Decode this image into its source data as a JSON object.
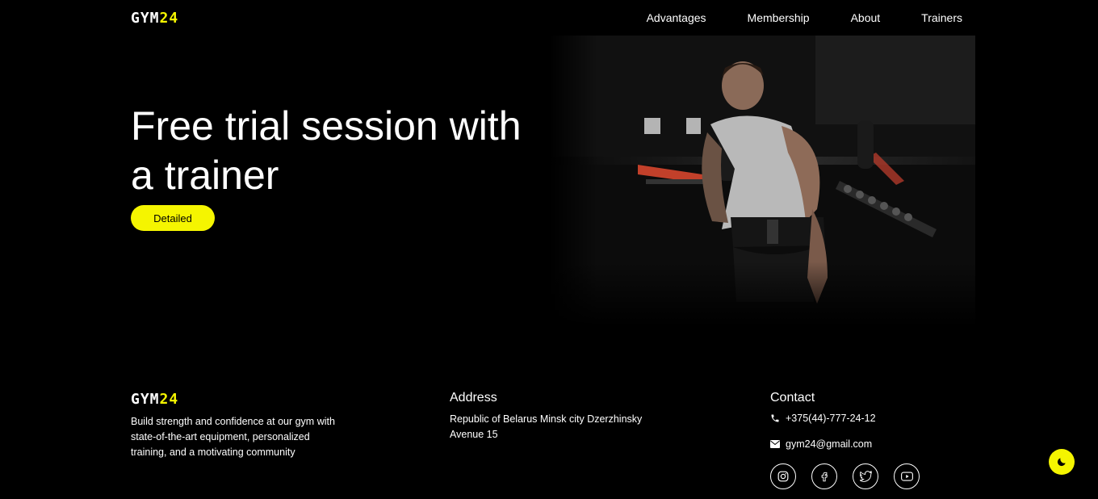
{
  "brand": {
    "logo_white": "GYM",
    "logo_yellow": "24"
  },
  "nav": {
    "items": [
      {
        "label": "Advantages"
      },
      {
        "label": "Membership"
      },
      {
        "label": "About"
      },
      {
        "label": "Trainers"
      }
    ]
  },
  "hero": {
    "title": "Free trial session with a trainer",
    "button_label": "Detailed",
    "image": "gym-trainer-photo"
  },
  "footer": {
    "about_text": "Build strength and confidence at our gym with state-of-the-art equipment, personalized training, and a motivating community",
    "address_title": "Address",
    "address_text": "Republic of Belarus Minsk city Dzerzhinsky Avenue 15",
    "contact_title": "Contact",
    "phone": "+375(44)-777-24-12",
    "email": "gym24@gmail.com",
    "socials": [
      "instagram-icon",
      "facebook-icon",
      "twitter-icon",
      "youtube-icon"
    ]
  },
  "colors": {
    "accent": "#f5f500",
    "background": "#000000",
    "text": "#ffffff"
  },
  "theme_toggle_icon": "moon-icon"
}
